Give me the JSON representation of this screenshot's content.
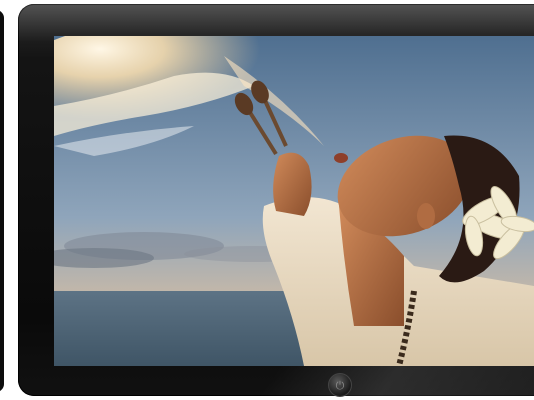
{
  "scene": {
    "subject": "fire-breather-photo",
    "device": "widescreen-monitor",
    "bezel_color": "#121212",
    "sky_colors": [
      "#4f6f90",
      "#8fa5bb",
      "#c7b9a8"
    ],
    "sea_color": "#4d6476",
    "fire_color": "#ffe9c4"
  },
  "icons": {
    "power": "power-icon"
  }
}
